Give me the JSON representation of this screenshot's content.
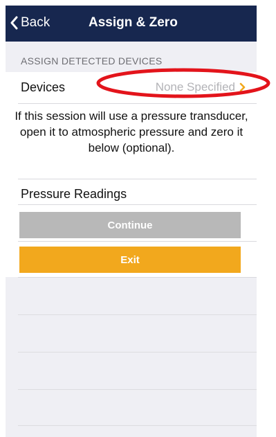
{
  "nav": {
    "back_label": "Back",
    "title": "Assign & Zero",
    "background": "#17274f"
  },
  "section": {
    "header": "ASSIGN DETECTED DEVICES"
  },
  "devices_row": {
    "label": "Devices",
    "value": "None Specified",
    "chevron_color": "#f2a81d"
  },
  "info": {
    "text": "If this session will use a pressure transducer, open it to atmospheric pressure and zero it below (optional)."
  },
  "pressure_row": {
    "label": "Pressure Readings"
  },
  "buttons": {
    "continue_label": "Continue",
    "continue_color": "#b8b8b8",
    "exit_label": "Exit",
    "exit_color": "#f2a81d"
  },
  "annotation": {
    "shape": "ellipse",
    "color": "#e3141b"
  },
  "icons": {
    "back": "chevron-left-icon",
    "disclosure": "chevron-right-icon"
  }
}
